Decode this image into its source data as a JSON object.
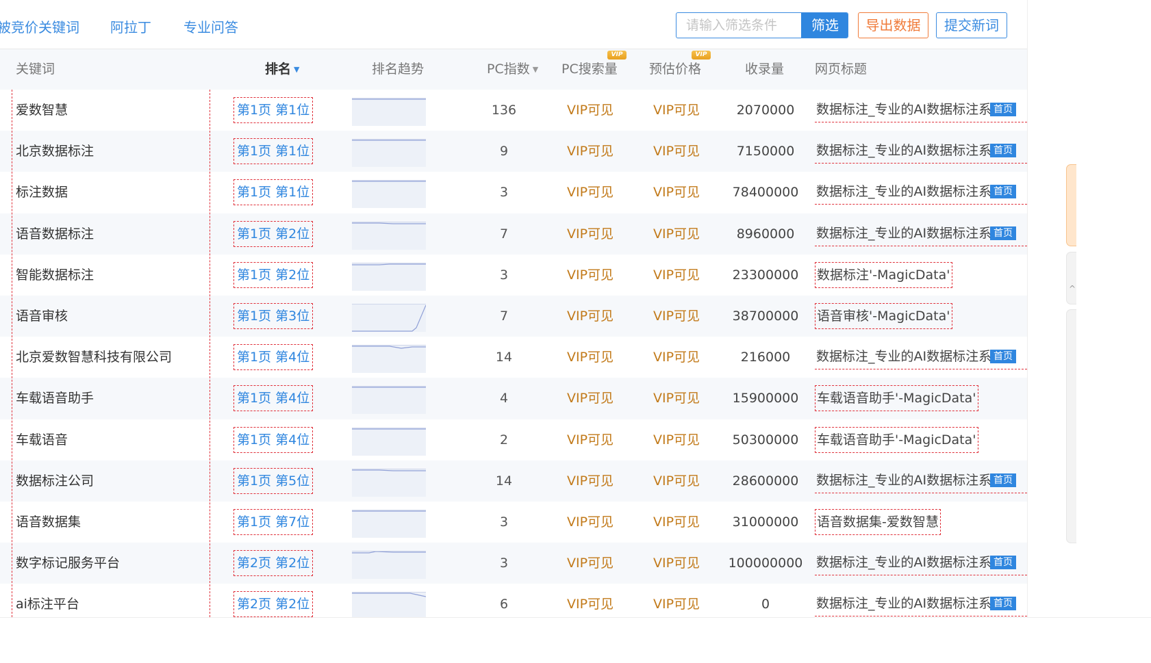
{
  "nav": {
    "items": [
      "被竞价关键词",
      "阿拉丁",
      "专业问答"
    ]
  },
  "toolbar": {
    "filter_placeholder": "请输入筛选条件",
    "filter_label": "筛选",
    "export_label": "导出数据",
    "submit_label": "提交新词"
  },
  "table": {
    "headers": {
      "keyword": "关键词",
      "rank": "排名",
      "trend": "排名趋势",
      "pc_index": "PC指数",
      "pc_search": "PC搜索量",
      "est_price": "预估价格",
      "indexed": "收录量",
      "page_title": "网页标题"
    },
    "vip_badge": "VIP",
    "home_badge": "首页",
    "rows": [
      {
        "keyword": "爱数智慧",
        "rank": "第1页 第1位",
        "pc_index": "136",
        "pc_search": "VIP可见",
        "est_price": "VIP可见",
        "indexed": "2070000",
        "title": "数据标注_专业的AI数据标注系",
        "home": true,
        "trend": "flat"
      },
      {
        "keyword": "北京数据标注",
        "rank": "第1页 第1位",
        "pc_index": "9",
        "pc_search": "VIP可见",
        "est_price": "VIP可见",
        "indexed": "7150000",
        "title": "数据标注_专业的AI数据标注系",
        "home": true,
        "trend": "flat"
      },
      {
        "keyword": "标注数据",
        "rank": "第1页 第1位",
        "pc_index": "3",
        "pc_search": "VIP可见",
        "est_price": "VIP可见",
        "indexed": "78400000",
        "title": "数据标注_专业的AI数据标注系",
        "home": true,
        "trend": "flat"
      },
      {
        "keyword": "语音数据标注",
        "rank": "第1页 第2位",
        "pc_index": "7",
        "pc_search": "VIP可见",
        "est_price": "VIP可见",
        "indexed": "8960000",
        "title": "数据标注_专业的AI数据标注系",
        "home": true,
        "trend": "slight-dip"
      },
      {
        "keyword": "智能数据标注",
        "rank": "第1页 第2位",
        "pc_index": "3",
        "pc_search": "VIP可见",
        "est_price": "VIP可见",
        "indexed": "23300000",
        "title": "数据标注'-MagicData'",
        "home": false,
        "trend": "slight-rise"
      },
      {
        "keyword": "语音审核",
        "rank": "第1页 第3位",
        "pc_index": "7",
        "pc_search": "VIP可见",
        "est_price": "VIP可见",
        "indexed": "38700000",
        "title": "语音审核'-MagicData'",
        "home": false,
        "trend": "spike"
      },
      {
        "keyword": "北京爱数智慧科技有限公司",
        "rank": "第1页 第4位",
        "pc_index": "14",
        "pc_search": "VIP可见",
        "est_price": "VIP可见",
        "indexed": "216000",
        "title": "数据标注_专业的AI数据标注系",
        "home": true,
        "trend": "wave"
      },
      {
        "keyword": "车载语音助手",
        "rank": "第1页 第4位",
        "pc_index": "4",
        "pc_search": "VIP可见",
        "est_price": "VIP可见",
        "indexed": "15900000",
        "title": "车载语音助手'-MagicData'",
        "home": false,
        "trend": "flat"
      },
      {
        "keyword": "车载语音",
        "rank": "第1页 第4位",
        "pc_index": "2",
        "pc_search": "VIP可见",
        "est_price": "VIP可见",
        "indexed": "50300000",
        "title": "车载语音助手'-MagicData'",
        "home": false,
        "trend": "flat"
      },
      {
        "keyword": "数据标注公司",
        "rank": "第1页 第5位",
        "pc_index": "14",
        "pc_search": "VIP可见",
        "est_price": "VIP可见",
        "indexed": "28600000",
        "title": "数据标注_专业的AI数据标注系",
        "home": true,
        "trend": "slight-dip"
      },
      {
        "keyword": "语音数据集",
        "rank": "第1页 第7位",
        "pc_index": "3",
        "pc_search": "VIP可见",
        "est_price": "VIP可见",
        "indexed": "31000000",
        "title": "语音数据集-爱数智慧",
        "home": false,
        "trend": "flat"
      },
      {
        "keyword": "数字标记服务平台",
        "rank": "第2页 第2位",
        "pc_index": "3",
        "pc_search": "VIP可见",
        "est_price": "VIP可见",
        "indexed": "100000000",
        "title": "数据标注_专业的AI数据标注系",
        "home": true,
        "trend": "bump"
      },
      {
        "keyword": "ai标注平台",
        "rank": "第2页 第2位",
        "pc_index": "6",
        "pc_search": "VIP可见",
        "est_price": "VIP可见",
        "indexed": "0",
        "title": "数据标注_专业的AI数据标注系",
        "home": true,
        "trend": "drop-end"
      }
    ]
  },
  "colors": {
    "accent": "#2f86df",
    "export": "#f07b3a",
    "vip_text": "#c27a1a",
    "dashed_guide": "#e0303a",
    "header_bg": "#f6f8fb"
  }
}
